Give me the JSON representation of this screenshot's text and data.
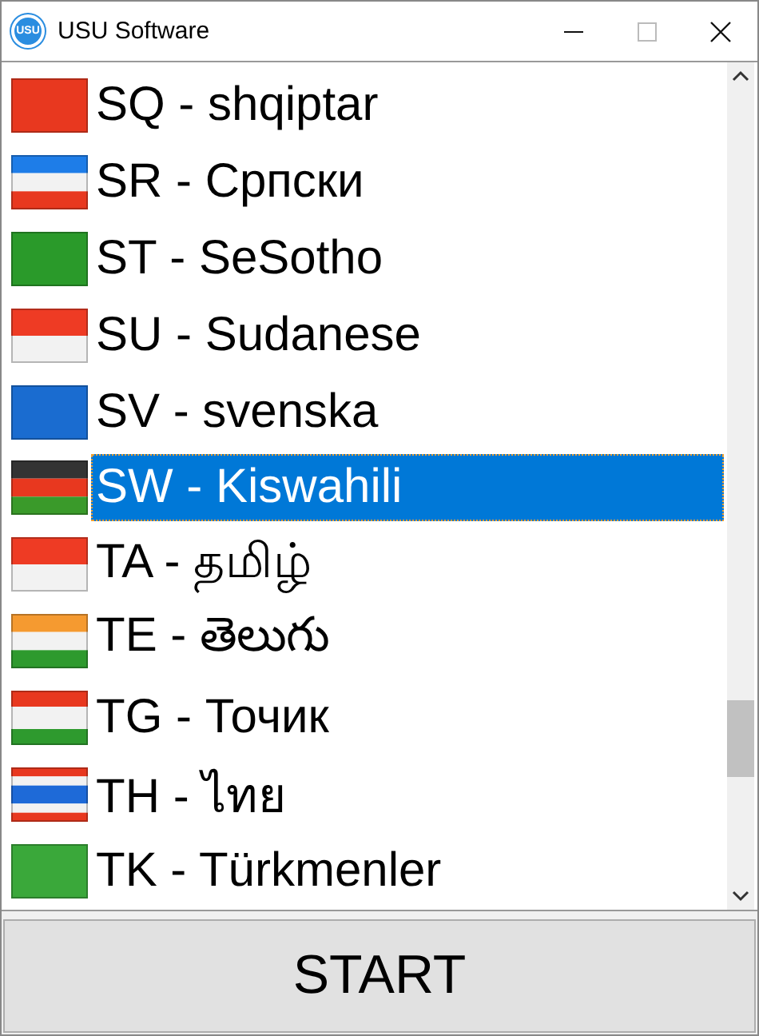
{
  "window": {
    "title": "USU Software",
    "logo": "USU"
  },
  "languages": [
    {
      "label": "SQ - shqiptar",
      "selected": false
    },
    {
      "label": "SR - Српски",
      "selected": false
    },
    {
      "label": "ST - SeSotho",
      "selected": false
    },
    {
      "label": "SU - Sudanese",
      "selected": false
    },
    {
      "label": "SV - svenska",
      "selected": false
    },
    {
      "label": "SW - Kiswahili",
      "selected": true
    },
    {
      "label": "TA - தமிழ்",
      "selected": false
    },
    {
      "label": "TE - తెలుగు",
      "selected": false
    },
    {
      "label": "TG - Точик",
      "selected": false
    },
    {
      "label": "TH - ไทย",
      "selected": false
    },
    {
      "label": "TK - Türkmenler",
      "selected": false
    }
  ],
  "start_button": "START"
}
